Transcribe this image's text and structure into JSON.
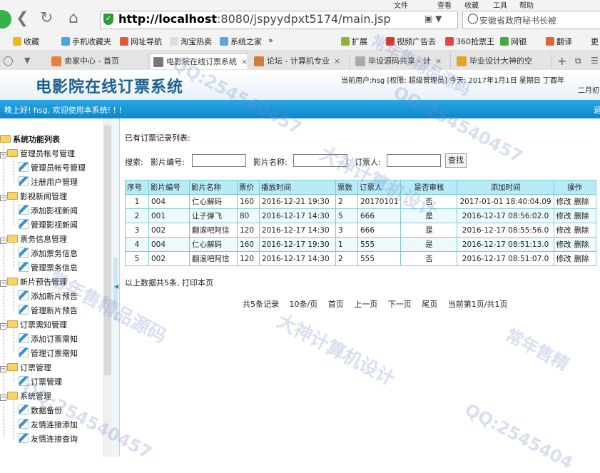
{
  "browser": {
    "menu": [
      "文件",
      "查看",
      "收藏",
      "工具",
      "帮助"
    ],
    "address_host": "http://localhost",
    "address_path": ":8080/jspyydpxt5174/main.jsp",
    "search_text": "安徽省政府秘书长被",
    "bookmarks": [
      "收藏",
      "手机收藏夹",
      "网址导航",
      "淘宝热卖",
      "系统之家",
      "»",
      "扩展",
      "视频广告去",
      "360抢票王",
      "网银",
      "翻译",
      "更"
    ],
    "tabs": [
      {
        "label": "卖家中心 - 首页",
        "color": "#e3823c"
      },
      {
        "label": "电影院在线订票系统",
        "color": "#6b6b6b"
      },
      {
        "label": "论坛 - 计算机专业",
        "color": "#d67a3a"
      },
      {
        "label": "毕设源码共享 - 计",
        "color": "#999999"
      },
      {
        "label": "毕业设计大神的空",
        "color": "#e5a327"
      }
    ]
  },
  "app": {
    "title": "电影院在线订票系统",
    "user_info": "当前用户:hsg [权限: 超级管理员] 今天:  2017年1月1日 星期日  丁酉年",
    "user_info_line2": "二月初",
    "welcome": "晚上好! hsg, 欢迎使用本系统! ! !",
    "welcome_right": "退"
  },
  "sidebar": {
    "root": "系统功能列表",
    "groups": [
      {
        "label": "管理员帐号管理",
        "items": [
          "管理员帐号管理",
          "注册用户管理"
        ]
      },
      {
        "label": "影视新闻管理",
        "items": [
          "添加影视新闻",
          "管理影视新闻"
        ]
      },
      {
        "label": "票务信息管理",
        "items": [
          "添加票务信息",
          "管理票务信息"
        ]
      },
      {
        "label": "新片预告管理",
        "items": [
          "添加新片预告",
          "管理新片预告"
        ]
      },
      {
        "label": "订票需知管理",
        "items": [
          "添加订票需知",
          "管理订票需知"
        ]
      },
      {
        "label": "订票管理",
        "items": [
          "订票管理"
        ]
      },
      {
        "label": "系统管理",
        "items": [
          "数据备份",
          "友情连接添加",
          "友情连接查询"
        ]
      }
    ]
  },
  "main": {
    "list_title": "已有订票记录列表:",
    "search_label": "搜索:",
    "filter_labels": [
      "影片编号:",
      "影片名称:",
      "订票人:"
    ],
    "search_button": "查找",
    "columns": [
      "序号",
      "影片编号",
      "影片名称",
      "票价",
      "播放时间",
      "票数",
      "订票人",
      "是否审核",
      "添加时间",
      "操作"
    ],
    "rows": [
      [
        "1",
        "004",
        "仁心解码",
        "160",
        "2016-12-21 19:30",
        "2",
        "20170101",
        "否",
        "2017-01-01 18:40:04.09"
      ],
      [
        "2",
        "001",
        "让子弹飞",
        "80",
        "2016-12-17 14:30",
        "5",
        "666",
        "是",
        "2016-12-17 08:56:02.0"
      ],
      [
        "3",
        "002",
        "翻滚吧阿信",
        "120",
        "2016-12-17 14:30",
        "3",
        "666",
        "是",
        "2016-12-17 08:55:56.0"
      ],
      [
        "4",
        "004",
        "仁心解码",
        "160",
        "2016-12-17 19:30",
        "1",
        "555",
        "是",
        "2016-12-17 08:51:13.0"
      ],
      [
        "5",
        "002",
        "翻滚吧阿信",
        "120",
        "2016-12-17 14:30",
        "2",
        "555",
        "否",
        "2016-12-17 08:51:07.0"
      ]
    ],
    "op_edit": "修改",
    "op_delete": "删除",
    "summary": "以上数据共5条, 打印本页",
    "pager": [
      "共5条记录",
      "10条/页",
      "首页",
      "上一页",
      "下一页",
      "尾页",
      "当前第1页/共1页"
    ]
  },
  "watermark": {
    "lines": [
      "QQ:254540457",
      "大神计算机设计",
      "常年售精品源码",
      "QQ:254540457",
      "大神计算机设计",
      "常年售精品源码",
      "QQ:254540457",
      "QQ:2545404",
      "常年售精"
    ]
  },
  "colors": {
    "header_blue_bar": "#1a97d8",
    "title_blue": "#1e5f8f",
    "table_header": "#b6ecf6",
    "table_border": "#7fc9d8"
  }
}
